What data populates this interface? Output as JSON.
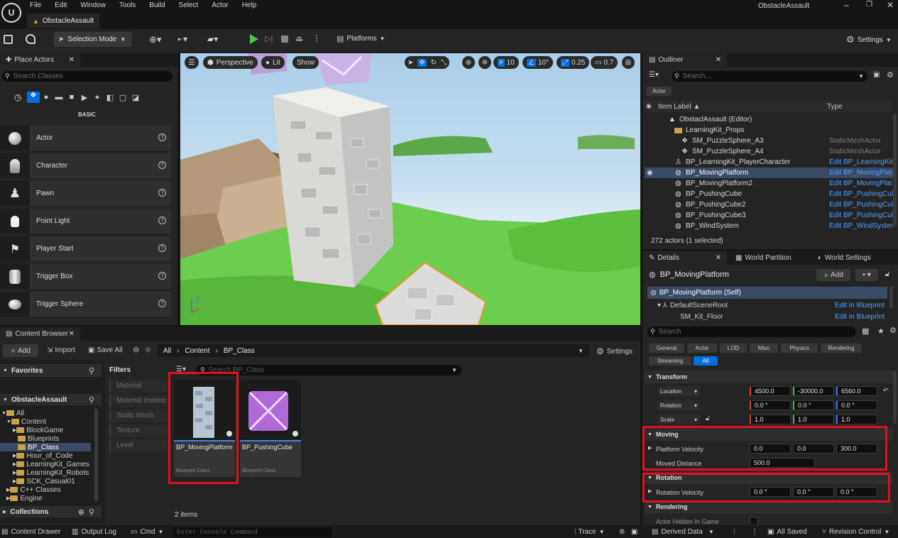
{
  "app": {
    "menu": [
      "File",
      "Edit",
      "Window",
      "Tools",
      "Build",
      "Select",
      "Actor",
      "Help"
    ],
    "project_name": "ObstacleAssault",
    "level_tab": "ObstacleAssault"
  },
  "toolbar": {
    "selection_mode": "Selection Mode",
    "platforms": "Platforms",
    "settings": "Settings"
  },
  "place_actors": {
    "tab": "Place Actors",
    "search_placeholder": "Search Classes",
    "category": "BASIC",
    "items": [
      {
        "label": "Actor",
        "icon": "sphere-icon"
      },
      {
        "label": "Character",
        "icon": "character-icon"
      },
      {
        "label": "Pawn",
        "icon": "pawn-icon"
      },
      {
        "label": "Point Light",
        "icon": "bulb-icon"
      },
      {
        "label": "Player Start",
        "icon": "flag-icon"
      },
      {
        "label": "Trigger Box",
        "icon": "box-icon"
      },
      {
        "label": "Trigger Sphere",
        "icon": "sphere-icon"
      }
    ]
  },
  "viewport": {
    "perspective": "Perspective",
    "lit": "Lit",
    "show": "Show",
    "grid_snap": "10",
    "rot_snap": "10°",
    "scale_snap": "0.25",
    "cam_speed": "0.7"
  },
  "outliner": {
    "tab": "Outliner",
    "search_placeholder": "Search...",
    "filter_chip": "Actor",
    "col_label": "Item Label ▲",
    "col_type": "Type",
    "rows": [
      {
        "name": "ObstaclAssault (Editor)",
        "type": ""
      },
      {
        "name": "LearningKit_Props",
        "type": ""
      },
      {
        "name": "SM_PuzzleSphere_A3",
        "type": "StaticMeshActor"
      },
      {
        "name": "SM_PuzzleSphere_A4",
        "type": "StaticMeshActor"
      },
      {
        "name": "BP_LearningKit_PlayerCharacter",
        "type": "Edit BP_LearningKit"
      },
      {
        "name": "BP_MovingPlatform",
        "type": "Edit BP_MovingPlat"
      },
      {
        "name": "BP_MovingPlatform2",
        "type": "Edit BP_MovingPlat"
      },
      {
        "name": "BP_PushingCube",
        "type": "Edit BP_PushingCul"
      },
      {
        "name": "BP_PushingCube2",
        "type": "Edit BP_PushingCul"
      },
      {
        "name": "BP_PushingCube3",
        "type": "Edit BP_PushingCul"
      },
      {
        "name": "BP_WindSystem",
        "type": "Edit BP_WindSyster"
      }
    ],
    "count": "272 actors (1 selected)"
  },
  "details": {
    "tab": "Details",
    "tab2": "World Partition",
    "tab3": "World Settings",
    "actor": "BP_MovingPlatform",
    "add": "Add",
    "self": "BP_MovingPlatform (Self)",
    "root": "DefaultSceneRoot",
    "root_link": "Edit in Blueprint",
    "floor": "SM_Kit_Floor",
    "floor_link": "Edit in Blueprint",
    "search_placeholder": "Search",
    "filters": [
      "General",
      "Actor",
      "LOD",
      "Misc",
      "Physics",
      "Rendering",
      "Streaming",
      "All"
    ],
    "transform": "Transform",
    "location": {
      "label": "Location",
      "x": "4500.0",
      "y": "-30000.0",
      "z": "6560.0"
    },
    "rotation": {
      "label": "Rotation",
      "x": "0.0 °",
      "y": "0.0 °",
      "z": "0.0 °"
    },
    "scale": {
      "label": "Scale",
      "x": "1.0",
      "y": "1.0",
      "z": "1.0"
    },
    "moving_cat": "Moving",
    "platform_velocity": {
      "label": "Platform Velocity",
      "x": "0.0",
      "y": "0.0",
      "z": "300.0"
    },
    "moved_distance": {
      "label": "Moved Distance",
      "value": "500.0"
    },
    "rotation_cat": "Rotation",
    "rotation_velocity": {
      "label": "Rotation Velocity",
      "x": "0.0 °",
      "y": "0.0 °",
      "z": "0.0 °"
    },
    "rendering_cat": "Rendering",
    "hidden_label": "Actor Hidden In Game"
  },
  "content_browser": {
    "tab": "Content Browser",
    "add": "Add",
    "import": "Import",
    "save_all": "Save All",
    "crumbs": [
      "All",
      "Content",
      "BP_Class"
    ],
    "settings": "Settings",
    "favorites": "Favorites",
    "project": "ObstacleAssault",
    "filters_label": "Filters",
    "search_placeholder": "Search BP_Class",
    "filters": [
      "Material",
      "Material Instanc",
      "Static Mesh",
      "Texture",
      "Level"
    ],
    "tree": [
      "All",
      "Content",
      "BlockGame",
      "Blueprints",
      "BP_Class",
      "Hour_of_Code",
      "LearningKit_Games",
      "LearningKit_Robots",
      "SCK_Casual01",
      "C++ Classes",
      "Engine"
    ],
    "collections": "Collections",
    "assets": [
      {
        "name": "BP_MovingPlatform",
        "type": "Blueprint Class"
      },
      {
        "name": "BP_PushingCube",
        "type": "Blueprint Class"
      }
    ],
    "count": "2 items"
  },
  "statusbar": {
    "content_drawer": "Content Drawer",
    "output_log": "Output Log",
    "cmd": "Cmd",
    "console_placeholder": "Enter Console Command",
    "trace": "Trace",
    "derived_data": "Derived Data",
    "all_saved": "All Saved",
    "revision": "Revision Control"
  },
  "colors": {
    "accent": "#0070e0",
    "selection": "#3a4a66",
    "highlight": "#e0101f",
    "link": "#4da1ff"
  }
}
